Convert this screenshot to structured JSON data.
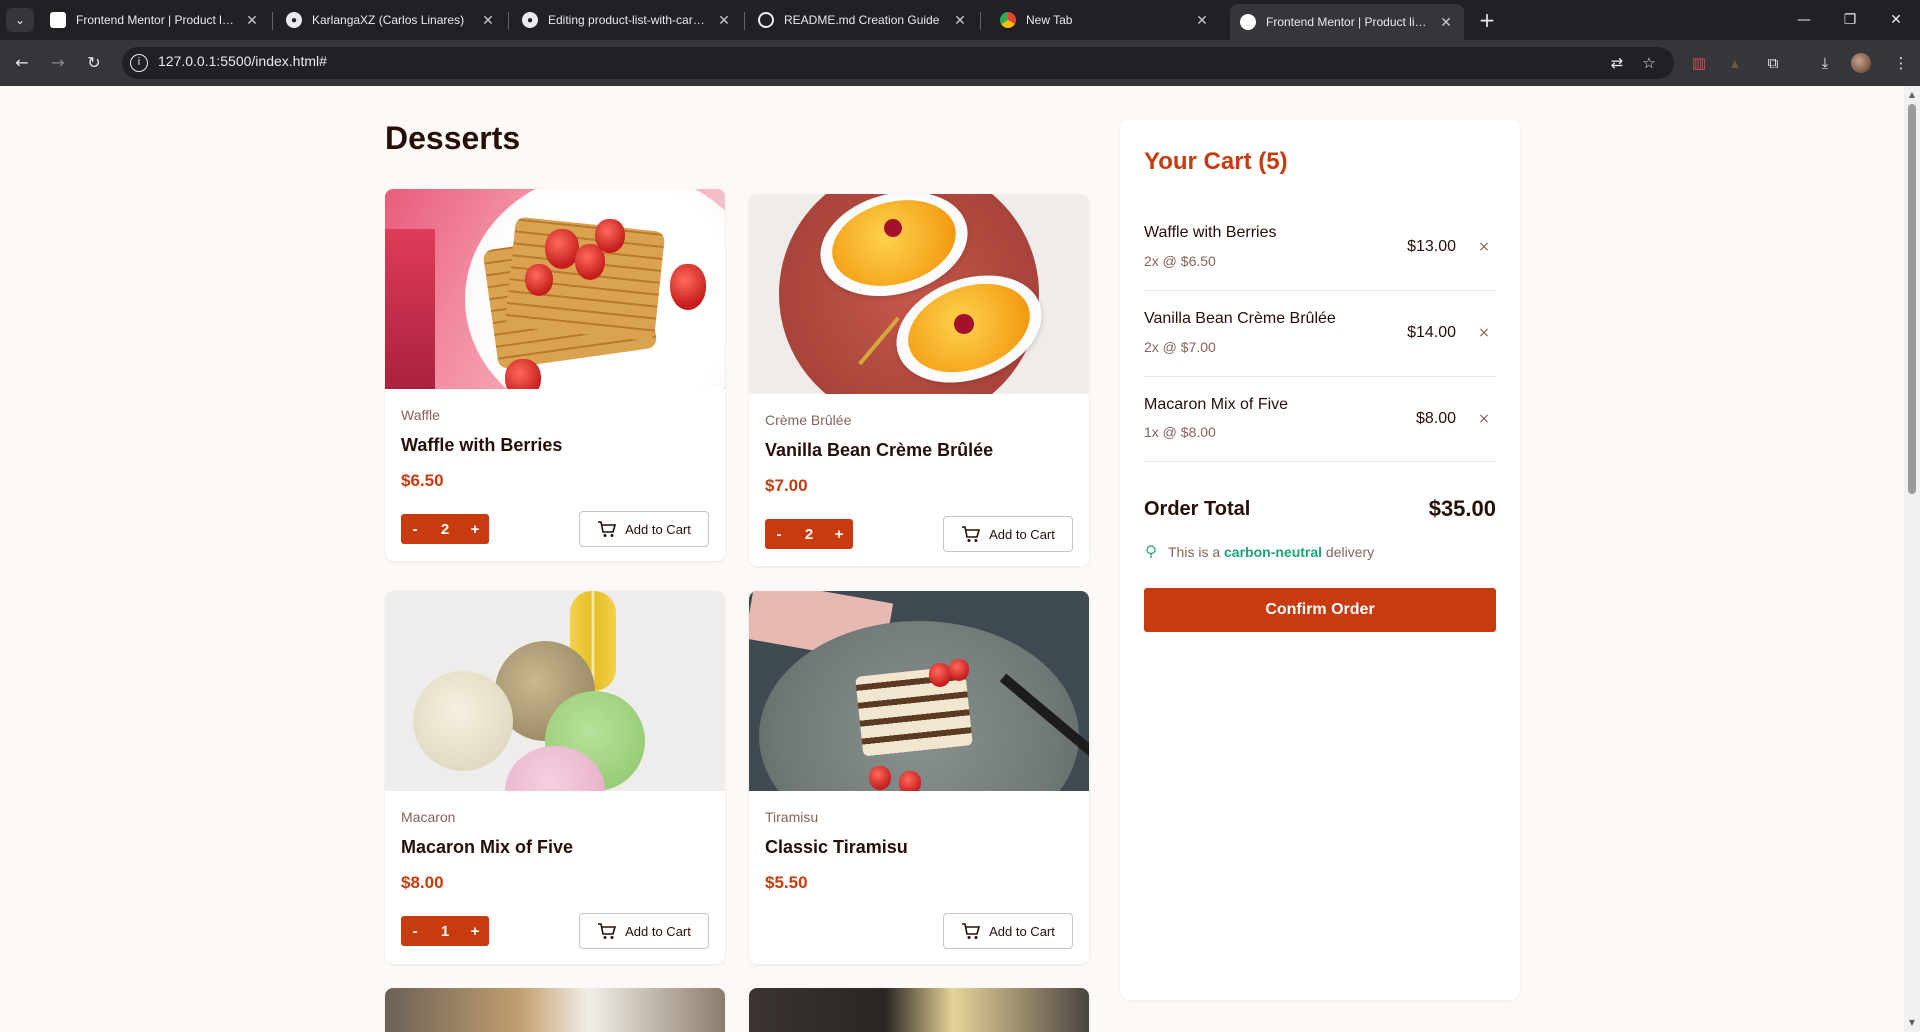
{
  "browser": {
    "tabs": [
      {
        "title": "Frontend Mentor | Product list w"
      },
      {
        "title": "KarlangaXZ (Carlos Linares)"
      },
      {
        "title": "Editing product-list-with-cart-m"
      },
      {
        "title": "README.md Creation Guide"
      },
      {
        "title": "New Tab"
      },
      {
        "title": "Frontend Mentor | Product list w"
      }
    ],
    "url": "127.0.0.1:5500/index.html#"
  },
  "page": {
    "title": "Desserts"
  },
  "products": [
    {
      "category": "Waffle",
      "name": "Waffle with Berries",
      "price": "$6.50",
      "qty": "2",
      "add_label": "Add to Cart"
    },
    {
      "category": "Crème Brûlée",
      "name": "Vanilla Bean Crème Brûlée",
      "price": "$7.00",
      "qty": "2",
      "add_label": "Add to Cart"
    },
    {
      "category": "Macaron",
      "name": "Macaron Mix of Five",
      "price": "$8.00",
      "qty": "1",
      "add_label": "Add to Cart"
    },
    {
      "category": "Tiramisu",
      "name": "Classic Tiramisu",
      "price": "$5.50",
      "add_label": "Add to Cart"
    }
  ],
  "stepper": {
    "minus": "-",
    "plus": "+"
  },
  "cart": {
    "title": "Your Cart (5)",
    "items": [
      {
        "name": "Waffle with Berries",
        "detail": "2x @ $6.50",
        "total": "$13.00"
      },
      {
        "name": "Vanilla Bean Crème Brûlée",
        "detail": "2x @ $7.00",
        "total": "$14.00"
      },
      {
        "name": "Macaron Mix of Five",
        "detail": "1x @ $8.00",
        "total": "$8.00"
      }
    ],
    "remove_glyph": "×",
    "order_total_label": "Order Total",
    "order_total_value": "$35.00",
    "carbon_prefix": "This is a ",
    "carbon_highlight": "carbon-neutral",
    "carbon_suffix": " delivery",
    "confirm_label": "Confirm Order"
  },
  "colors": {
    "accent": "#c73b0f",
    "green": "#1ea575",
    "text": "#260f08",
    "muted": "#87635a"
  }
}
